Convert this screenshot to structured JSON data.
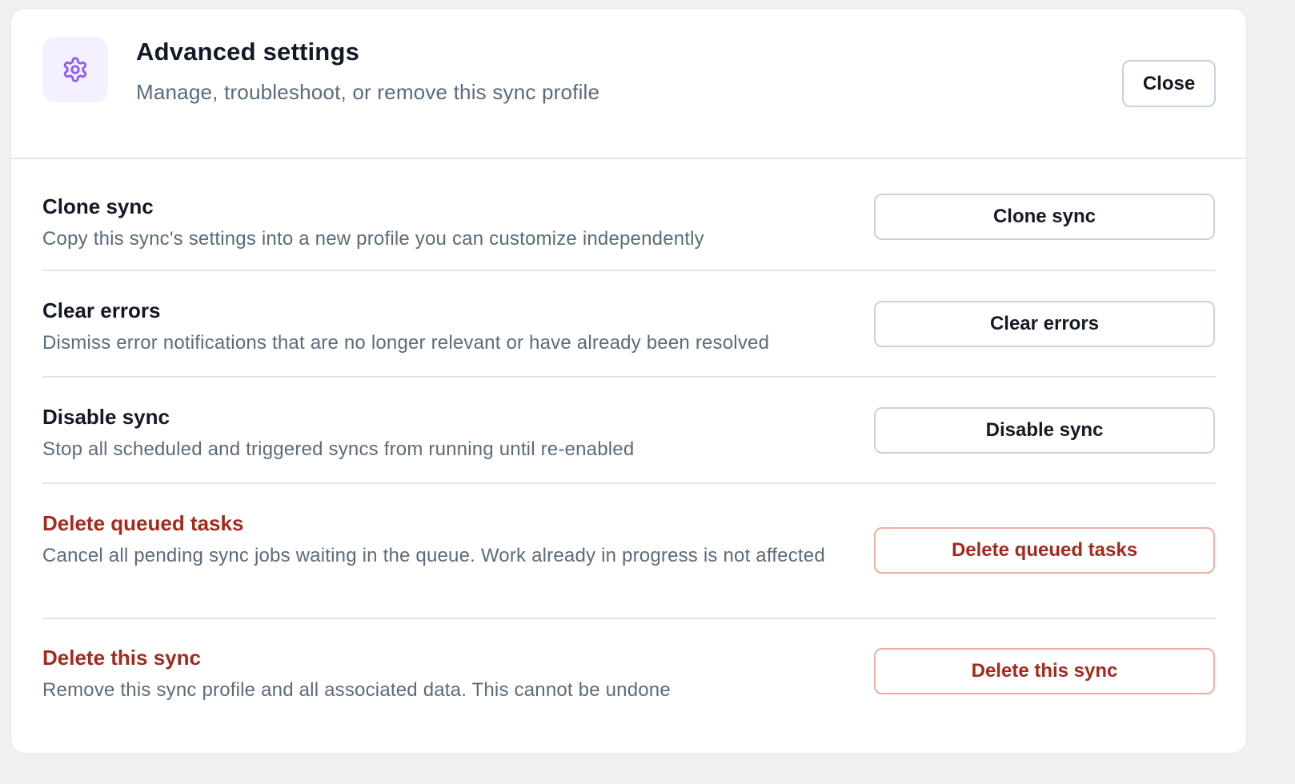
{
  "header": {
    "icon": "gear-icon",
    "title": "Advanced settings",
    "subtitle": "Manage, troubleshoot, or remove this sync profile",
    "close_label": "Close"
  },
  "actions": [
    {
      "title": "Clone sync",
      "description": "Copy this sync's settings into a new profile you can customize independently",
      "button_label": "Clone sync",
      "danger": false
    },
    {
      "title": "Clear errors",
      "description": "Dismiss error notifications that are no longer relevant or have already been resolved",
      "button_label": "Clear errors",
      "danger": false
    },
    {
      "title": "Disable sync",
      "description": "Stop all scheduled and triggered syncs from running until re-enabled",
      "button_label": "Disable sync",
      "danger": false
    },
    {
      "title": "Delete queued tasks",
      "description": "Cancel all pending sync jobs waiting in the queue. Work already in progress is not affected",
      "button_label": "Delete queued tasks",
      "danger": true
    },
    {
      "title": "Delete this sync",
      "description": "Remove this sync profile and all associated data. This cannot be undone",
      "button_label": "Delete this sync",
      "danger": true
    }
  ],
  "colors": {
    "accent_purple": "#8b5cf6",
    "danger_red": "#a42a1c",
    "danger_border": "#eeaca3",
    "muted_text": "#5a6b7b"
  }
}
